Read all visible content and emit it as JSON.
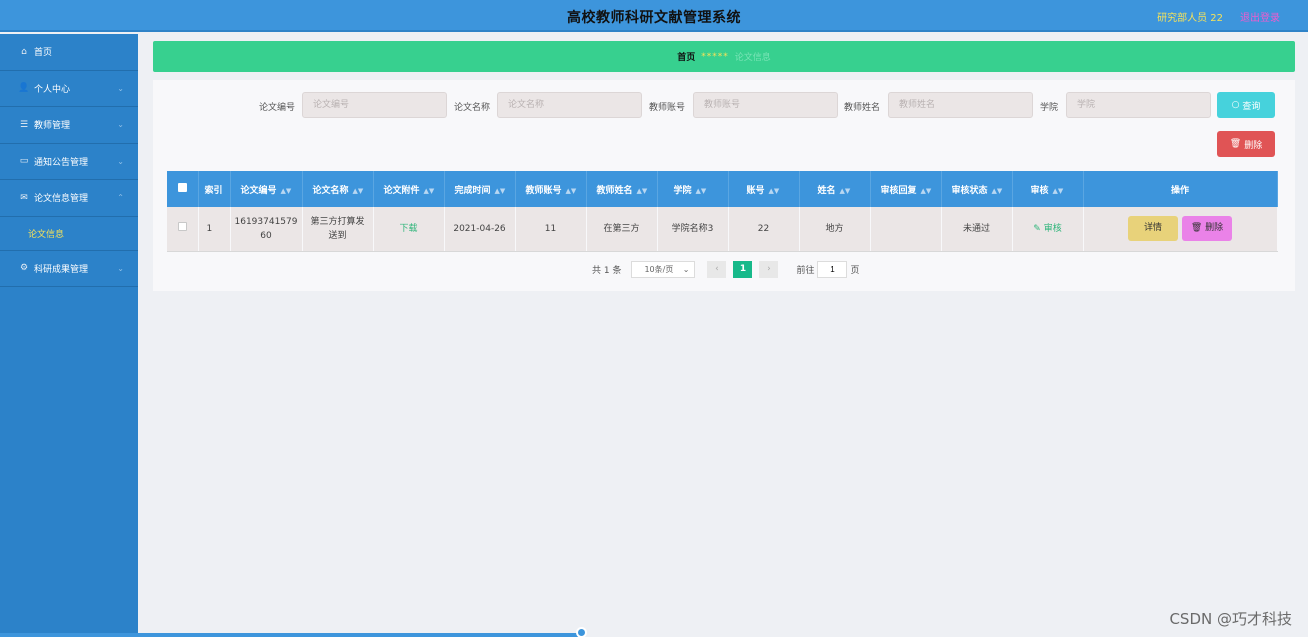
{
  "header": {
    "title": "高校教师科研文献管理系统",
    "user": "研究部人员 22",
    "logout": "退出登录"
  },
  "sidebar": {
    "items": [
      {
        "label": "首页",
        "icon": "home-icon"
      },
      {
        "label": "个人中心",
        "icon": "user-icon"
      },
      {
        "label": "教师管理",
        "icon": "list-icon"
      },
      {
        "label": "通知公告管理",
        "icon": "message-icon"
      },
      {
        "label": "论文信息管理",
        "icon": "mail-icon"
      },
      {
        "label": "科研成果管理",
        "icon": "gear-icon"
      }
    ],
    "active_sub": "论文信息"
  },
  "breadcrumb": {
    "home": "首页",
    "separator": "*****",
    "current": "论文信息"
  },
  "search": {
    "fields": [
      {
        "label": "论文编号",
        "placeholder": "论文编号"
      },
      {
        "label": "论文名称",
        "placeholder": "论文名称"
      },
      {
        "label": "教师账号",
        "placeholder": "教师账号"
      },
      {
        "label": "教师姓名",
        "placeholder": "教师姓名"
      },
      {
        "label": "学院",
        "placeholder": "学院"
      }
    ],
    "query_label": "查询",
    "delete_label": "删除"
  },
  "table": {
    "headers": [
      "索引",
      "论文编号",
      "论文名称",
      "论文附件",
      "完成时间",
      "教师账号",
      "教师姓名",
      "学院",
      "账号",
      "姓名",
      "审核回复",
      "审核状态",
      "审核",
      "操作"
    ],
    "rows": [
      {
        "index": "1",
        "paper_no": "1619374157960",
        "paper_no_l1": "16193741579",
        "paper_no_l2": "60",
        "title_l1": "第三方打算发",
        "title_l2": "送到",
        "attachment": "下载",
        "date": "2021-04-26",
        "teacher_account": "11",
        "teacher_name": "在第三方",
        "college": "学院名称3",
        "account": "22",
        "name": "地方",
        "reply": "",
        "status": "未通过",
        "review": "审核",
        "detail": "详情",
        "delete": "删除"
      }
    ]
  },
  "pagination": {
    "total": "共 1 条",
    "page_size": "10条/页",
    "current_page": "1",
    "goto_label": "前往",
    "goto_value": "1",
    "page_unit": "页"
  },
  "watermark": "CSDN @巧才科技",
  "colors": {
    "header": "#3d95dc",
    "sidebar": "#2c82c9",
    "breadcrumb": "#37d08f",
    "query": "#46d2dc",
    "delete": "#e05455",
    "detail": "#e8d27a",
    "row_delete": "#ea82e8",
    "pager_active": "#17b98a"
  }
}
